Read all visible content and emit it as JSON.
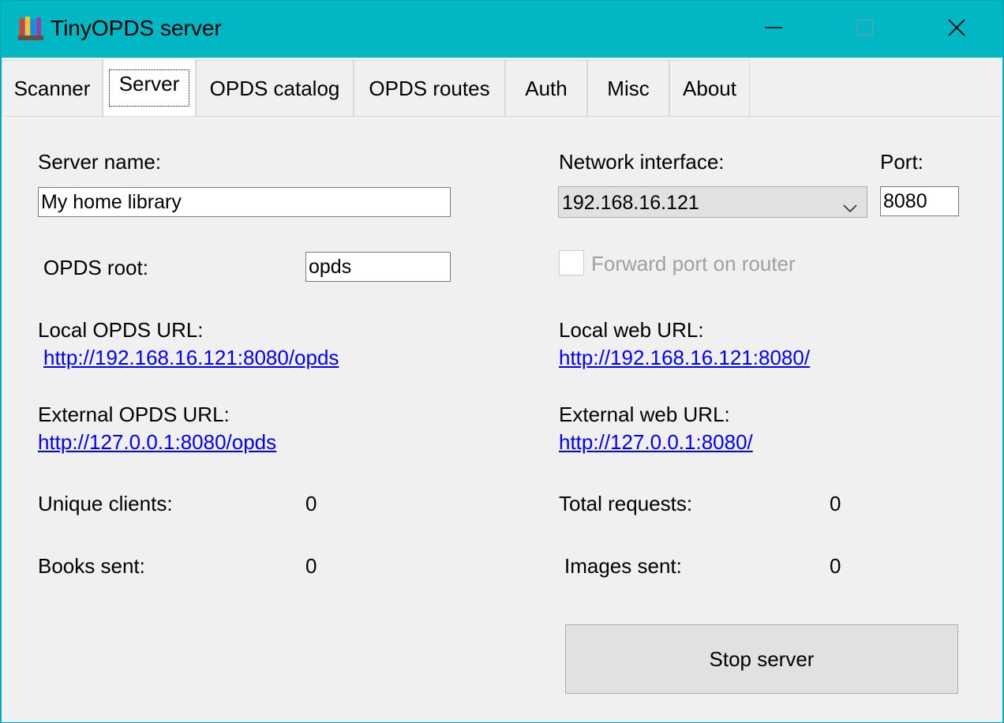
{
  "window": {
    "title": "TinyOPDS server",
    "icon": "books-icon",
    "controls": [
      "minimize-icon",
      "maximize-icon",
      "close-icon"
    ],
    "accent_color": "#00b7c3"
  },
  "tabs": [
    {
      "label": "Scanner",
      "selected": false
    },
    {
      "label": "Server",
      "selected": true
    },
    {
      "label": "OPDS catalog",
      "selected": false
    },
    {
      "label": "OPDS routes",
      "selected": false
    },
    {
      "label": "Auth",
      "selected": false
    },
    {
      "label": "Misc",
      "selected": false
    },
    {
      "label": "About",
      "selected": false
    }
  ],
  "server": {
    "server_name_label": "Server name:",
    "server_name_value": "My home library",
    "opds_root_label": "OPDS root:",
    "opds_root_value": "opds",
    "network_interface_label": "Network interface:",
    "network_interface_value": "192.168.16.121",
    "port_label": "Port:",
    "port_value": "8080",
    "forward_port_label": "Forward port on router",
    "forward_port_checked": false,
    "local_opds_url_label": "Local OPDS URL:",
    "local_opds_url": "http://192.168.16.121:8080/opds",
    "external_opds_url_label": "External OPDS URL:",
    "external_opds_url": "http://127.0.0.1:8080/opds",
    "local_web_url_label": "Local web URL:",
    "local_web_url": "http://192.168.16.121:8080/",
    "external_web_url_label": "External web URL:",
    "external_web_url": "http://127.0.0.1:8080/",
    "unique_clients_label": "Unique clients:",
    "unique_clients_value": "0",
    "books_sent_label": "Books sent:",
    "books_sent_value": "0",
    "total_requests_label": "Total requests:",
    "total_requests_value": "0",
    "images_sent_label": "Images sent:",
    "images_sent_value": "0",
    "stop_button_label": "Stop server",
    "link_color": "#0000ff"
  }
}
